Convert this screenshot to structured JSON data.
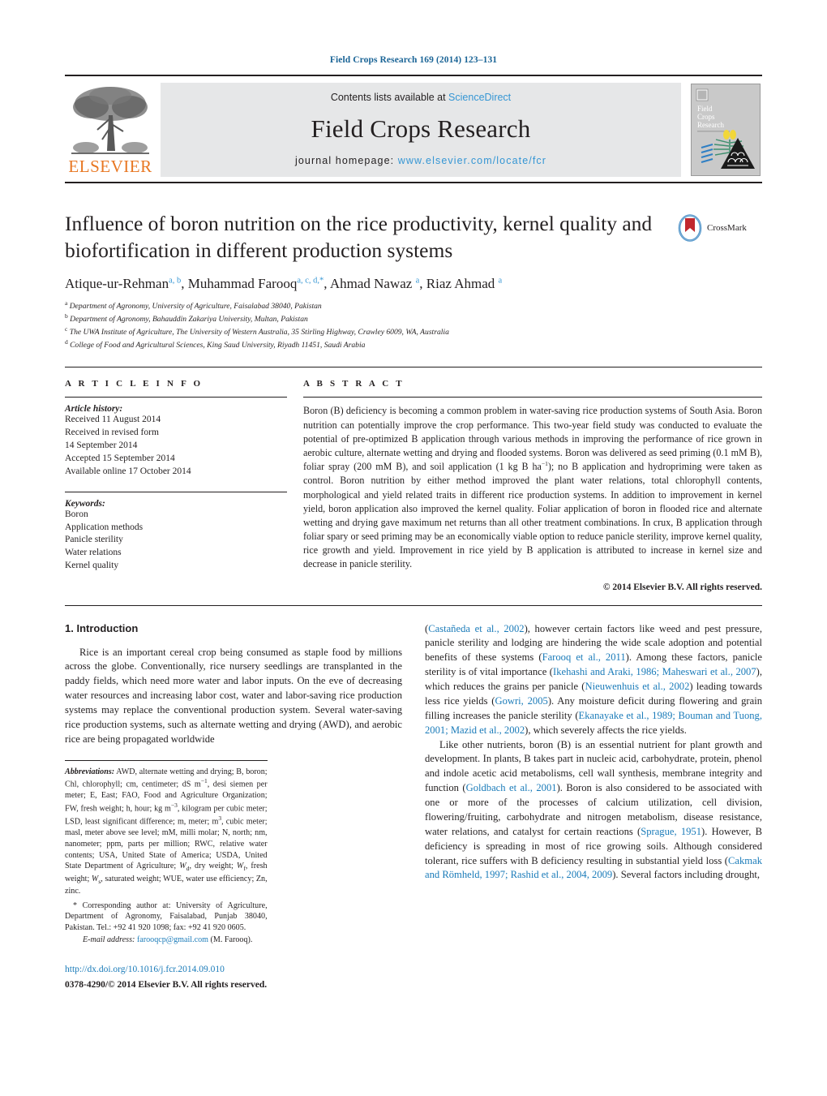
{
  "running_head": "Field Crops Research 169 (2014) 123–131",
  "masthead": {
    "publisher_logo_label": "ELSEVIER",
    "contents_prefix": "Contents lists available at ",
    "contents_link": "ScienceDirect",
    "journal_title": "Field Crops Research",
    "homepage_prefix": "journal homepage: ",
    "homepage_url": "www.elsevier.com/locate/fcr",
    "cover_caption": "Field Crops Research"
  },
  "article": {
    "title": "Influence of boron nutrition on the rice productivity, kernel quality and biofortification in different production systems",
    "crossmark_label": "CrossMark",
    "authors_html": "Atique-ur-Rehman<sup>a, b</sup>, Muhammad Farooq<sup>a, c, d,</sup><sup>*</sup>, Ahmad Nawaz <sup>a</sup>, Riaz Ahmad <sup>a</sup>",
    "affiliations": [
      {
        "mark": "a",
        "text": "Department of Agronomy, University of Agriculture, Faisalabad 38040, Pakistan"
      },
      {
        "mark": "b",
        "text": "Department of Agronomy, Bahauddin Zakariya University, Multan, Pakistan"
      },
      {
        "mark": "c",
        "text": "The UWA Institute of Agriculture, The University of Western Australia, 35 Stirling Highway, Crawley 6009, WA, Australia"
      },
      {
        "mark": "d",
        "text": "College of Food and Agricultural Sciences, King Saud University, Riyadh 11451, Saudi Arabia"
      }
    ]
  },
  "article_info": {
    "heading": "A R T I C L E    I N F O",
    "history_label": "Article history:",
    "history_lines": [
      "Received 11 August 2014",
      "Received in revised form",
      "14 September 2014",
      "Accepted 15 September 2014",
      "Available online 17 October 2014"
    ],
    "keywords_label": "Keywords:",
    "keywords": [
      "Boron",
      "Application methods",
      "Panicle sterility",
      "Water relations",
      "Kernel quality"
    ]
  },
  "abstract": {
    "heading": "A B S T R A C T",
    "body_html": "Boron (B) deficiency is becoming a common problem in water-saving rice production systems of South Asia. Boron nutrition can potentially improve the crop performance. This two-year field study was conducted to evaluate the potential of pre-optimized B application through various methods in improving the performance of rice grown in aerobic culture, alternate wetting and drying and flooded systems. Boron was delivered as seed priming (0.1 mM B), foliar spray (200 mM B), and soil application (1 kg B ha<sup class=\"sp\">−1</sup>); no B application and hydropriming were taken as control. Boron nutrition by either method improved the plant water relations, total chlorophyll contents, morphological and yield related traits in different rice production systems. In addition to improvement in kernel yield, boron application also improved the kernel quality. Foliar application of boron in flooded rice and alternate wetting and drying gave maximum net returns than all other treatment combinations. In crux, B application through foliar spary or seed priming may be an economically viable option to reduce panicle sterility, improve kernel quality, rice growth and yield. Improvement in rice yield by B application is attributed to increase in kernel size and decrease in panicle sterility.",
    "copyright": "© 2014 Elsevier B.V. All rights reserved."
  },
  "introduction": {
    "heading": "1.  Introduction",
    "left_paragraph_html": "Rice is an important cereal crop being consumed as staple food by millions across the globe. Conventionally, rice nursery seedlings are transplanted in the paddy fields, which need more water and labor inputs. On the eve of decreasing water resources and increasing labor cost, water and labor-saving rice production systems may replace the conventional production system. Several water-saving rice production systems, such as alternate wetting and drying (AWD), and aerobic rice are being propagated worldwide",
    "right_paragraph_1_html": "(<span class=\"ref\">Castañeda et al., 2002</span>), however certain factors like weed and pest pressure, panicle sterility and lodging are hindering the wide scale adoption and potential benefits of these systems (<span class=\"ref\">Farooq et al., 2011</span>). Among these factors, panicle sterility is of vital importance (<span class=\"ref\">Ikehashi and Araki, 1986; Maheswari et al., 2007</span>), which reduces the grains per panicle (<span class=\"ref\">Nieuwenhuis et al., 2002</span>) leading towards less rice yields (<span class=\"ref\">Gowri, 2005</span>). Any moisture deficit during flowering and grain filling increases the panicle sterility (<span class=\"ref\">Ekanayake et al., 1989; Bouman and Tuong, 2001; Mazid et al., 2002</span>), which severely affects the rice yields.",
    "right_paragraph_2_html": "Like other nutrients, boron (B) is an essential nutrient for plant growth and development. In plants, B takes part in nucleic acid, carbohydrate, protein, phenol and indole acetic acid metabolisms, cell wall synthesis, membrane integrity and function (<span class=\"ref\">Goldbach et al., 2001</span>). Boron is also considered to be associated with one or more of the processes of calcium utilization, cell division, flowering/fruiting, carbohydrate and nitrogen metabolism, disease resistance, water relations, and catalyst for certain reactions (<span class=\"ref\">Sprague, 1951</span>). However, B deficiency is spreading in most of rice growing soils. Although considered tolerant, rice suffers with B deficiency resulting in substantial yield loss (<span class=\"ref\">Cakmak and Römheld, 1997; Rashid et al., 2004, 2009</span>). Several factors including drought,"
  },
  "footnotes": {
    "abbreviations_html": "<span class=\"it\">Abbreviations:</span>  AWD, alternate wetting and drying; B, boron; Chl, chlorophyll; cm, centimeter; dS m<sup class=\"sp\">−1</sup>, desi siemen per meter; E, East; FAO, Food and Agriculture Organization; FW, fresh weight; h, hour; kg m<sup class=\"sp\">−3</sup>, kilogram per cubic meter; LSD, least significant difference; m, meter; m<sup class=\"sp\">3</sup>, cubic meter; masl, meter above see level; mM, milli molar; N, north; nm, nanometer; ppm, parts per million; RWC, relative water contents; USA, United State of America; USDA, United State Department of Agriculture; <span class=\"bi\">W</span><sub class=\"sb\">d</sub>, dry weight; <span class=\"bi\">W</span><sub class=\"sb\">f</sub>, fresh weight; <span class=\"bi\">W</span><sub class=\"sb\">s</sub>, saturated weight; WUE, water use efficiency; Zn, zinc.",
    "corresponding_html": "* Corresponding author at: University of Agriculture, Department of Agronomy, Faisalabad, Punjab 38040, Pakistan. Tel.: +92 41 920 1098; fax: +92 41 920 0605.",
    "email_label": "E-mail address:",
    "email_address": "farooqcp@gmail.com",
    "email_owner": "(M. Farooq)."
  },
  "footer": {
    "doi_url": "http://dx.doi.org/10.1016/j.fcr.2014.09.010",
    "issn_line": "0378-4290/© 2014 Elsevier B.V. All rights reserved."
  }
}
